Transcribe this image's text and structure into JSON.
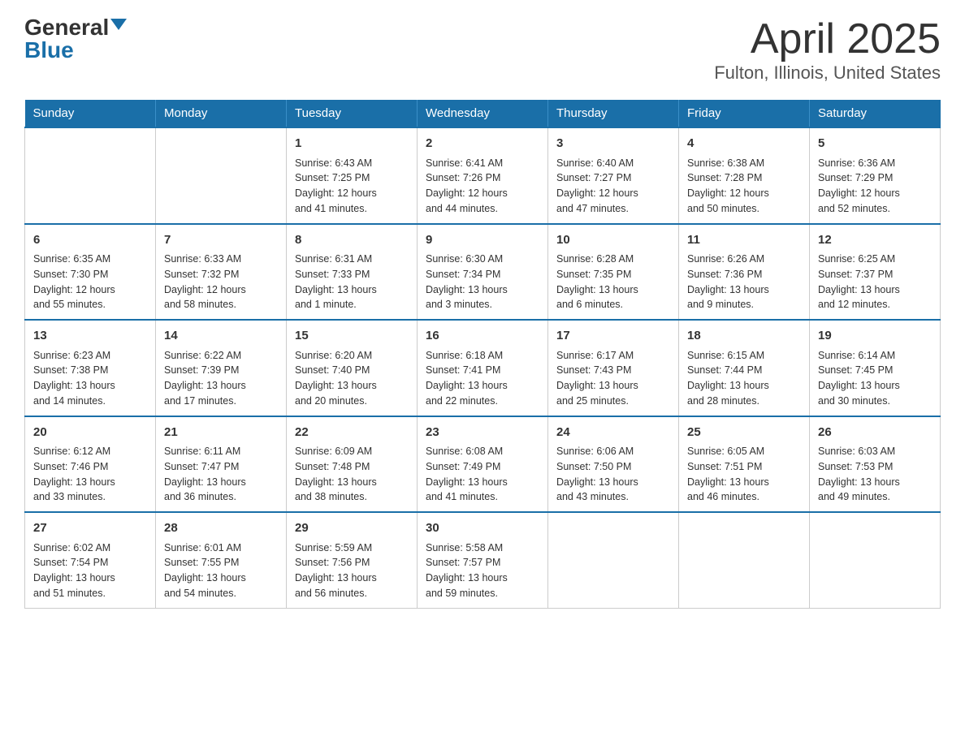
{
  "header": {
    "logo_general": "General",
    "logo_blue": "Blue",
    "title": "April 2025",
    "subtitle": "Fulton, Illinois, United States"
  },
  "days_of_week": [
    "Sunday",
    "Monday",
    "Tuesday",
    "Wednesday",
    "Thursday",
    "Friday",
    "Saturday"
  ],
  "weeks": [
    [
      {
        "day": "",
        "info": ""
      },
      {
        "day": "",
        "info": ""
      },
      {
        "day": "1",
        "info": "Sunrise: 6:43 AM\nSunset: 7:25 PM\nDaylight: 12 hours\nand 41 minutes."
      },
      {
        "day": "2",
        "info": "Sunrise: 6:41 AM\nSunset: 7:26 PM\nDaylight: 12 hours\nand 44 minutes."
      },
      {
        "day": "3",
        "info": "Sunrise: 6:40 AM\nSunset: 7:27 PM\nDaylight: 12 hours\nand 47 minutes."
      },
      {
        "day": "4",
        "info": "Sunrise: 6:38 AM\nSunset: 7:28 PM\nDaylight: 12 hours\nand 50 minutes."
      },
      {
        "day": "5",
        "info": "Sunrise: 6:36 AM\nSunset: 7:29 PM\nDaylight: 12 hours\nand 52 minutes."
      }
    ],
    [
      {
        "day": "6",
        "info": "Sunrise: 6:35 AM\nSunset: 7:30 PM\nDaylight: 12 hours\nand 55 minutes."
      },
      {
        "day": "7",
        "info": "Sunrise: 6:33 AM\nSunset: 7:32 PM\nDaylight: 12 hours\nand 58 minutes."
      },
      {
        "day": "8",
        "info": "Sunrise: 6:31 AM\nSunset: 7:33 PM\nDaylight: 13 hours\nand 1 minute."
      },
      {
        "day": "9",
        "info": "Sunrise: 6:30 AM\nSunset: 7:34 PM\nDaylight: 13 hours\nand 3 minutes."
      },
      {
        "day": "10",
        "info": "Sunrise: 6:28 AM\nSunset: 7:35 PM\nDaylight: 13 hours\nand 6 minutes."
      },
      {
        "day": "11",
        "info": "Sunrise: 6:26 AM\nSunset: 7:36 PM\nDaylight: 13 hours\nand 9 minutes."
      },
      {
        "day": "12",
        "info": "Sunrise: 6:25 AM\nSunset: 7:37 PM\nDaylight: 13 hours\nand 12 minutes."
      }
    ],
    [
      {
        "day": "13",
        "info": "Sunrise: 6:23 AM\nSunset: 7:38 PM\nDaylight: 13 hours\nand 14 minutes."
      },
      {
        "day": "14",
        "info": "Sunrise: 6:22 AM\nSunset: 7:39 PM\nDaylight: 13 hours\nand 17 minutes."
      },
      {
        "day": "15",
        "info": "Sunrise: 6:20 AM\nSunset: 7:40 PM\nDaylight: 13 hours\nand 20 minutes."
      },
      {
        "day": "16",
        "info": "Sunrise: 6:18 AM\nSunset: 7:41 PM\nDaylight: 13 hours\nand 22 minutes."
      },
      {
        "day": "17",
        "info": "Sunrise: 6:17 AM\nSunset: 7:43 PM\nDaylight: 13 hours\nand 25 minutes."
      },
      {
        "day": "18",
        "info": "Sunrise: 6:15 AM\nSunset: 7:44 PM\nDaylight: 13 hours\nand 28 minutes."
      },
      {
        "day": "19",
        "info": "Sunrise: 6:14 AM\nSunset: 7:45 PM\nDaylight: 13 hours\nand 30 minutes."
      }
    ],
    [
      {
        "day": "20",
        "info": "Sunrise: 6:12 AM\nSunset: 7:46 PM\nDaylight: 13 hours\nand 33 minutes."
      },
      {
        "day": "21",
        "info": "Sunrise: 6:11 AM\nSunset: 7:47 PM\nDaylight: 13 hours\nand 36 minutes."
      },
      {
        "day": "22",
        "info": "Sunrise: 6:09 AM\nSunset: 7:48 PM\nDaylight: 13 hours\nand 38 minutes."
      },
      {
        "day": "23",
        "info": "Sunrise: 6:08 AM\nSunset: 7:49 PM\nDaylight: 13 hours\nand 41 minutes."
      },
      {
        "day": "24",
        "info": "Sunrise: 6:06 AM\nSunset: 7:50 PM\nDaylight: 13 hours\nand 43 minutes."
      },
      {
        "day": "25",
        "info": "Sunrise: 6:05 AM\nSunset: 7:51 PM\nDaylight: 13 hours\nand 46 minutes."
      },
      {
        "day": "26",
        "info": "Sunrise: 6:03 AM\nSunset: 7:53 PM\nDaylight: 13 hours\nand 49 minutes."
      }
    ],
    [
      {
        "day": "27",
        "info": "Sunrise: 6:02 AM\nSunset: 7:54 PM\nDaylight: 13 hours\nand 51 minutes."
      },
      {
        "day": "28",
        "info": "Sunrise: 6:01 AM\nSunset: 7:55 PM\nDaylight: 13 hours\nand 54 minutes."
      },
      {
        "day": "29",
        "info": "Sunrise: 5:59 AM\nSunset: 7:56 PM\nDaylight: 13 hours\nand 56 minutes."
      },
      {
        "day": "30",
        "info": "Sunrise: 5:58 AM\nSunset: 7:57 PM\nDaylight: 13 hours\nand 59 minutes."
      },
      {
        "day": "",
        "info": ""
      },
      {
        "day": "",
        "info": ""
      },
      {
        "day": "",
        "info": ""
      }
    ]
  ]
}
